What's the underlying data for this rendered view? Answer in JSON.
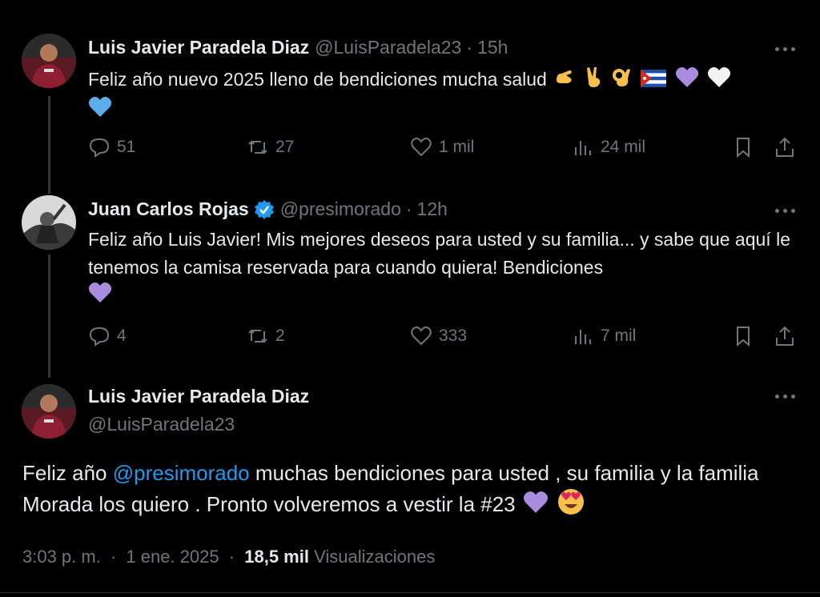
{
  "tweets": [
    {
      "name": "Luis Javier Paradela Diaz",
      "handle": "@LuisParadela23",
      "time": "15h",
      "text": "Feliz año nuevo 2025 lleno de bendiciones  mucha salud",
      "emojis": [
        "call-me-hand",
        "victory-hand",
        "ok-hand",
        "cuba-flag",
        "purple-heart",
        "white-heart",
        "blue-heart"
      ],
      "stats": {
        "replies": "51",
        "reposts": "27",
        "likes": "1 mil",
        "views": "24 mil"
      }
    },
    {
      "name": "Juan Carlos Rojas",
      "handle": "@presimorado",
      "time": "12h",
      "verified": true,
      "text": "Feliz año Luis Javier! Mis mejores deseos para usted y su familia... y sabe que aquí le tenemos la camisa reservada para cuando quiera! Bendiciones",
      "emojis": [
        "purple-heart"
      ],
      "stats": {
        "replies": "4",
        "reposts": "2",
        "likes": "333",
        "views": "7 mil"
      }
    },
    {
      "name": "Luis Javier Paradela Diaz",
      "handle": "@LuisParadela23",
      "text_before": "Feliz año ",
      "mention": "@presimorado",
      "text_after": " muchas bendiciones para usted , su familia y la familia Morada los quiero . Pronto volveremos a vestir la #23",
      "emojis": [
        "purple-heart",
        "heart-eyes"
      ],
      "time_full": "3:03 p. m.",
      "date": "1 ene. 2025",
      "views_count": "18,5 mil",
      "views_label": "Visualizaciones"
    }
  ],
  "separator": "·",
  "colors": {
    "background": "#000000",
    "text": "#e7e9ea",
    "muted": "#71767b",
    "link": "#1d9bf0",
    "verified": "#1d9bf0"
  }
}
